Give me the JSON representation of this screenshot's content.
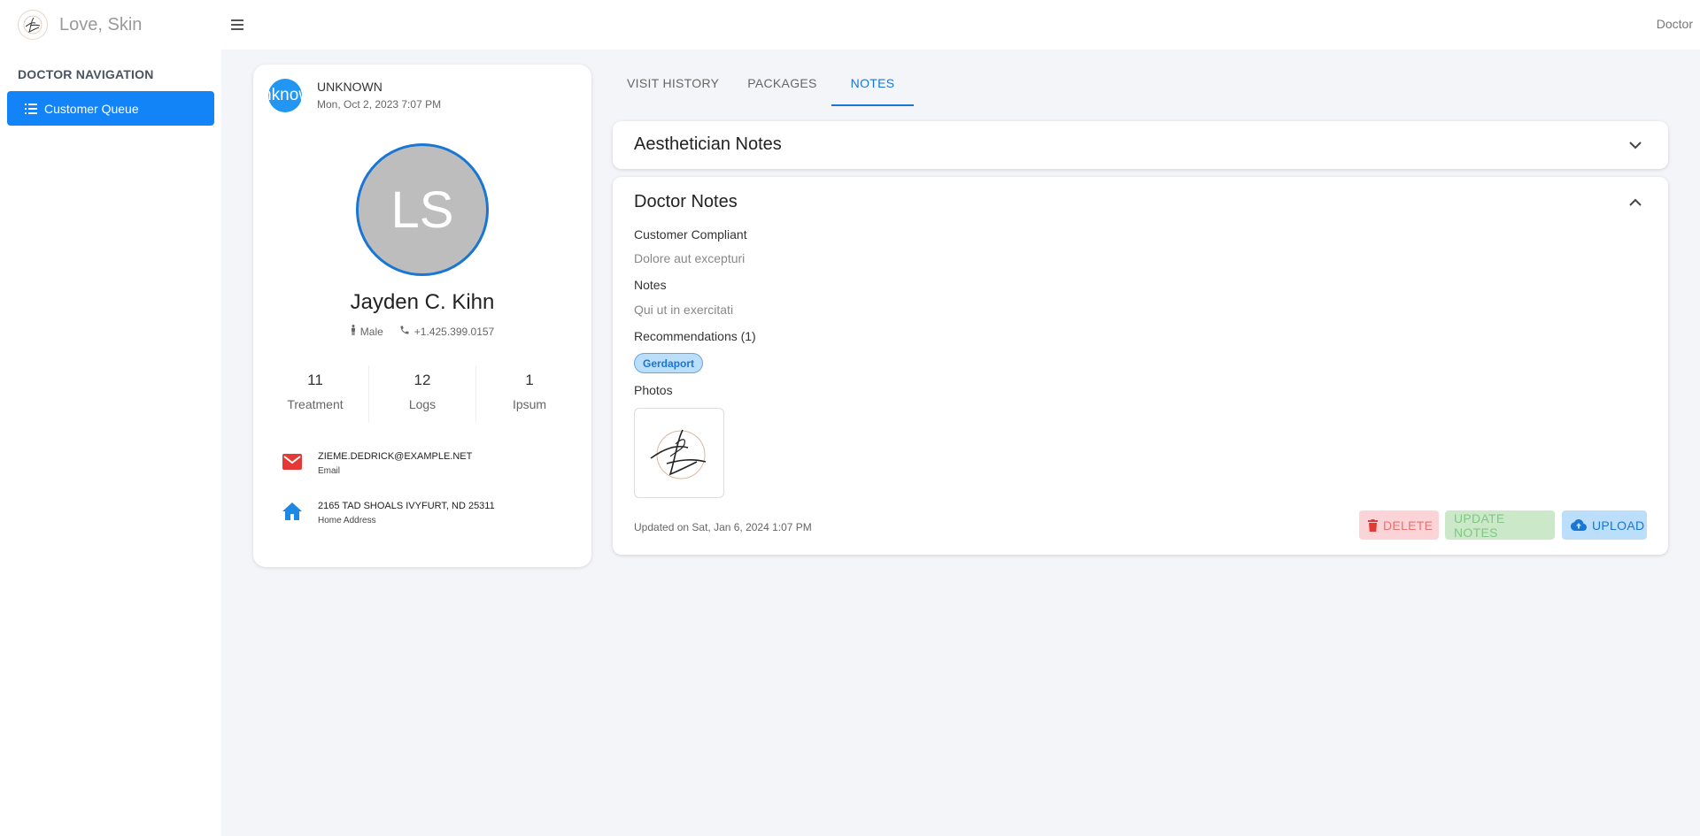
{
  "app": {
    "title": "Love, Skin",
    "user_role": "Doctor"
  },
  "sidebar": {
    "heading": "DOCTOR NAVIGATION",
    "items": [
      {
        "label": "Customer Queue",
        "icon": "list-icon",
        "active": true
      }
    ]
  },
  "profile": {
    "source_avatar_text": "Unknown",
    "source_name": "UNKNOWN",
    "source_date": "Mon, Oct 2, 2023 7:07 PM",
    "initials": "LS",
    "name": "Jayden C. Kihn",
    "gender": "Male",
    "phone": "+1.425.399.0157",
    "stats": [
      {
        "value": "11",
        "label": "Treatment"
      },
      {
        "value": "12",
        "label": "Logs"
      },
      {
        "value": "1",
        "label": "Ipsum"
      }
    ],
    "email": {
      "value": "ZIEME.DEDRICK@EXAMPLE.NET",
      "label": "Email"
    },
    "address": {
      "value": "2165 TAD SHOALS IVYFURT, ND 25311",
      "label": "Home Address"
    }
  },
  "tabs": [
    {
      "label": "VISIT HISTORY",
      "active": false
    },
    {
      "label": "PACKAGES",
      "active": false
    },
    {
      "label": "NOTES",
      "active": true
    }
  ],
  "aesthetician_notes": {
    "title": "Aesthetician Notes",
    "expanded": false
  },
  "doctor_notes": {
    "title": "Doctor Notes",
    "expanded": true,
    "complaint_label": "Customer Compliant",
    "complaint_value": "Dolore aut excepturi",
    "notes_label": "Notes",
    "notes_value": "Qui ut in exercitati",
    "recommendations_label": "Recommendations (1)",
    "recommendations": [
      "Gerdaport"
    ],
    "photos_label": "Photos",
    "updated": "Updated on Sat, Jan 6, 2024 1:07 PM",
    "buttons": {
      "delete": "DELETE",
      "update": "UPDATE NOTES",
      "upload": "UPLOAD"
    }
  },
  "colors": {
    "primary": "#1976d2",
    "sidebar_active": "#1383f8",
    "email_icon": "#e53935",
    "home_icon": "#1e88e5",
    "delete_bg": "#fcd3d7",
    "update_bg": "#cbe9c9",
    "upload_bg": "#bbdefb"
  }
}
